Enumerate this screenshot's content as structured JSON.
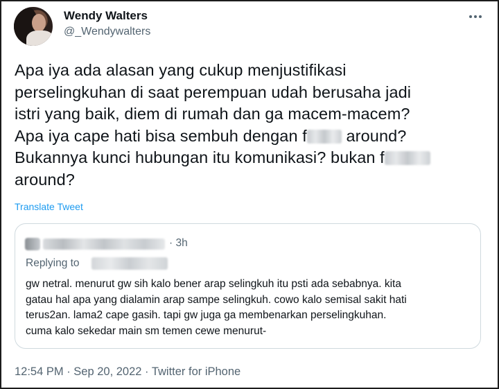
{
  "user": {
    "name": "Wendy Walters",
    "handle": "@_Wendywalters"
  },
  "tweet": {
    "line1": "Apa iya ada alasan yang cukup menjustifikasi",
    "line2": "perselingkuhan di saat perempuan udah berusaha jadi",
    "line3": "istri yang baik, diem di rumah dan ga macem-macem?",
    "line4a": "Apa iya cape hati bisa sembuh dengan f",
    "line4b": " around?",
    "line5a": "Bukannya kunci hubungan itu komunikasi? bukan f",
    "line6": "around?"
  },
  "translate_label": "Translate Tweet",
  "quoted": {
    "time": "· 3h",
    "replying_to": "Replying to",
    "text": "gw netral. menurut gw sih kalo bener arap selingkuh itu psti ada sebabnya. kita\ngatau hal apa yang dialamin arap sampe selingkuh. cowo kalo semisal sakit hati\nterus2an. lama2 cape gasih. tapi gw juga ga membenarkan perselingkuhan.\ncuma kalo sekedar main sm temen cewe menurut-"
  },
  "meta": "12:54 PM · Sep 20, 2022 · Twitter for iPhone",
  "icons": {
    "more": "more-horizontal-icon"
  }
}
